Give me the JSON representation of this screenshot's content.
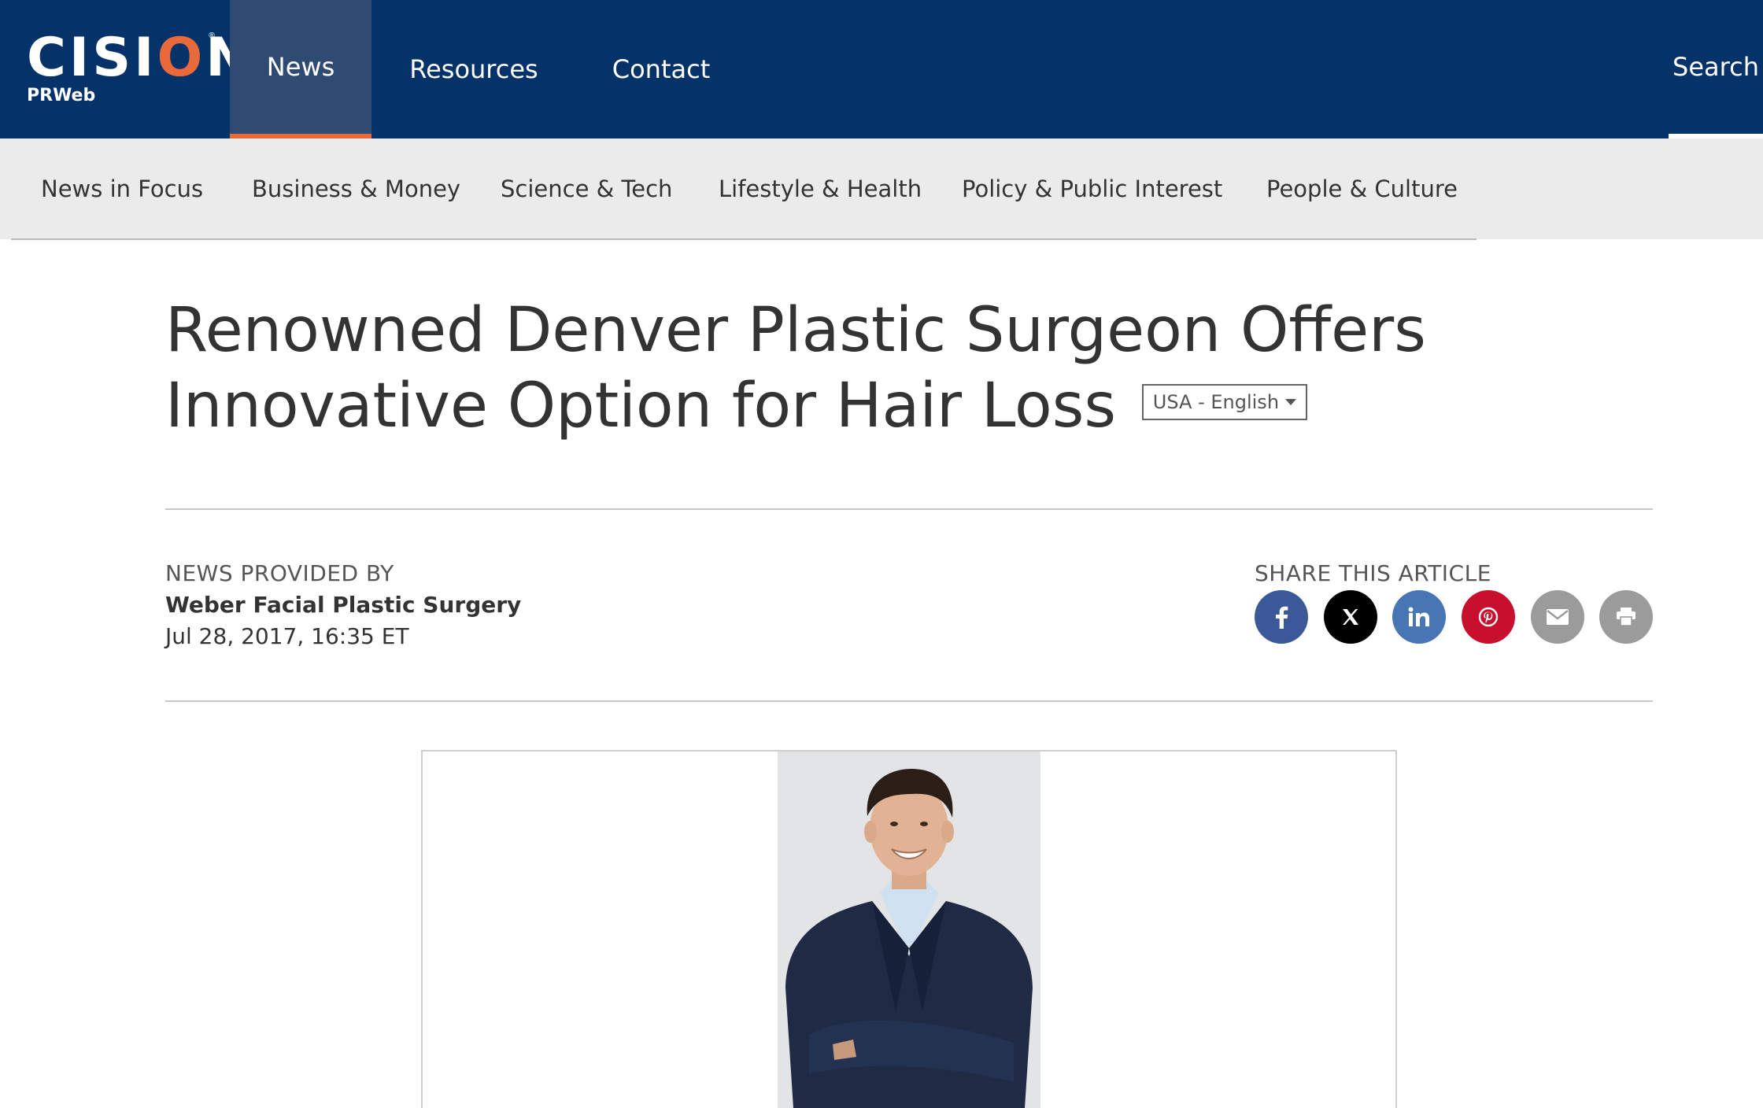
{
  "brand": {
    "logo_text_1": "CISI",
    "logo_text_accent": "O",
    "logo_text_2": "N",
    "logo_sub": "PRWeb",
    "trademark": "®",
    "accent_color": "#e8693a",
    "nav_color": "#053269"
  },
  "nav": {
    "tabs": [
      {
        "label": "News",
        "active": true
      },
      {
        "label": "Resources",
        "active": false
      },
      {
        "label": "Contact",
        "active": false
      }
    ],
    "search_label": "Search"
  },
  "categories": [
    "News in Focus",
    "Business & Money",
    "Science & Tech",
    "Lifestyle & Health",
    "Policy & Public Interest",
    "People & Culture"
  ],
  "article": {
    "title_line_1": "Renowned Denver Plastic Surgeon Offers",
    "title_line_2": "Innovative Option for Hair Loss",
    "language": "USA - English",
    "provided_label": "NEWS PROVIDED BY",
    "provider": "Weber Facial Plastic Surgery",
    "date": "Jul 28, 2017, 16:35 ET"
  },
  "share": {
    "label": "SHARE THIS ARTICLE",
    "buttons": [
      {
        "name": "facebook",
        "icon": "facebook-icon",
        "color": "#3b5998"
      },
      {
        "name": "x",
        "icon": "x-icon",
        "color": "#000000"
      },
      {
        "name": "linkedin",
        "icon": "linkedin-icon",
        "color": "#4875b4"
      },
      {
        "name": "pinterest",
        "icon": "pinterest-icon",
        "color": "#c8102e"
      },
      {
        "name": "email",
        "icon": "email-icon",
        "color": "#9b9b9b"
      },
      {
        "name": "print",
        "icon": "print-icon",
        "color": "#9b9b9b"
      }
    ]
  },
  "photo": {
    "icon": "portrait-photo"
  }
}
